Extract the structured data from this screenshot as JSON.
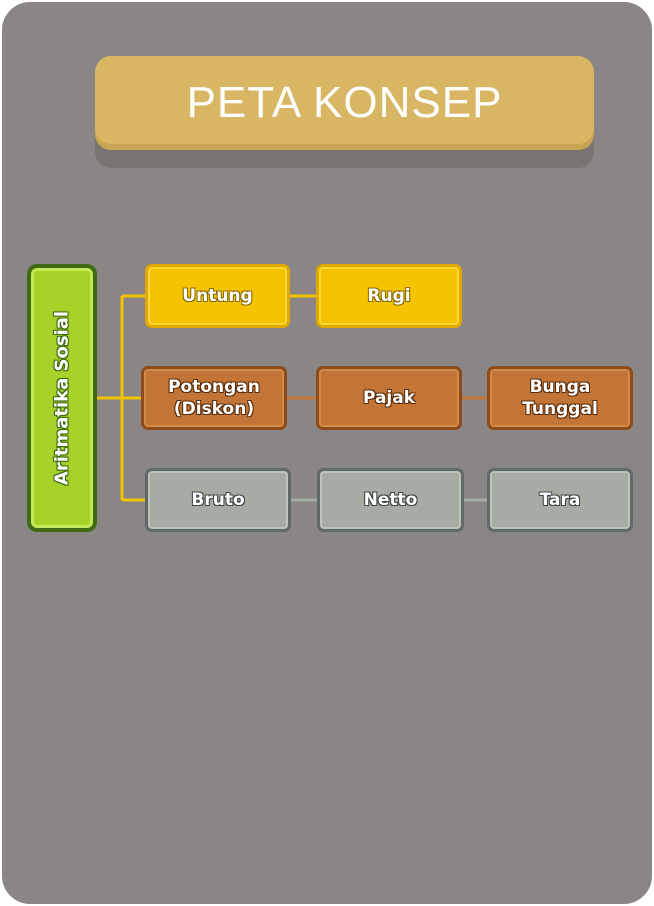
{
  "title": "PETA KONSEP",
  "root": {
    "label": "Aritmatika Sosial",
    "color": "#a8d12a"
  },
  "rows": [
    {
      "color": "#f5c400",
      "nodes": [
        {
          "line1": "Untung",
          "line2": ""
        },
        {
          "line1": "Rugi",
          "line2": ""
        }
      ]
    },
    {
      "color": "#c27536",
      "nodes": [
        {
          "line1": "Potongan",
          "line2": "(Diskon)"
        },
        {
          "line1": "Pajak",
          "line2": ""
        },
        {
          "line1": "Bunga",
          "line2": "Tunggal"
        }
      ]
    },
    {
      "color": "#a5aca4",
      "nodes": [
        {
          "line1": "Bruto",
          "line2": ""
        },
        {
          "line1": "Netto",
          "line2": ""
        },
        {
          "line1": "Tara",
          "line2": ""
        }
      ]
    }
  ]
}
